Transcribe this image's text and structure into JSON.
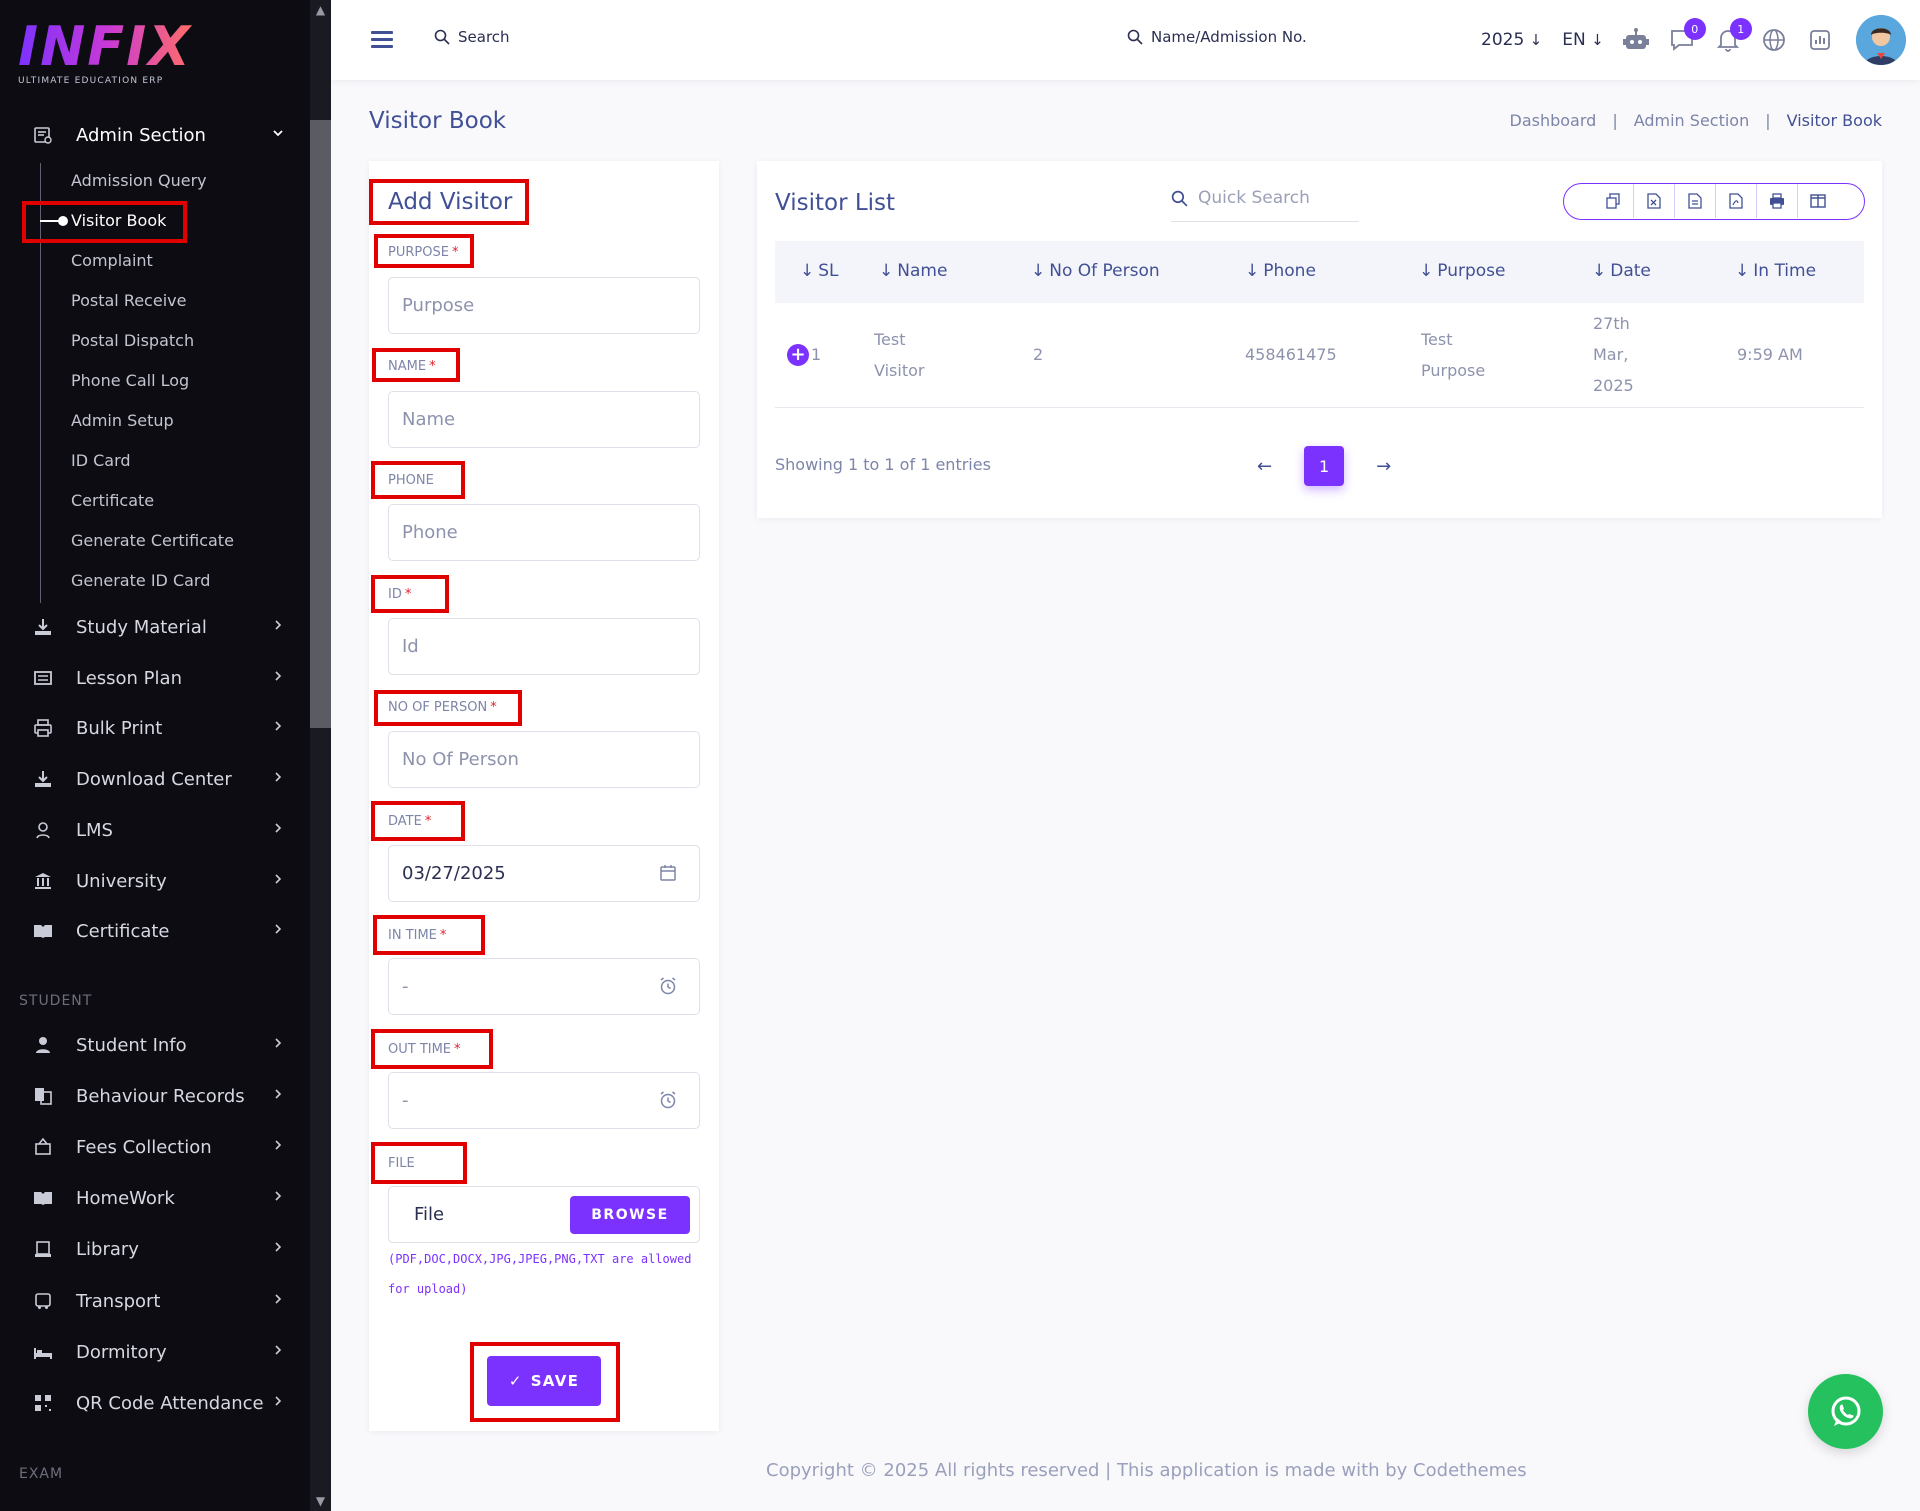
{
  "brand": {
    "logo": "INFIX",
    "tagline": "ULTIMATE EDUCATION ERP"
  },
  "sidebar": {
    "admin_section": "Admin Section",
    "submenu": [
      "Admission Query",
      "Visitor Book",
      "Complaint",
      "Postal Receive",
      "Postal Dispatch",
      "Phone Call Log",
      "Admin Setup",
      "ID Card",
      "Certificate",
      "Generate Certificate",
      "Generate ID Card"
    ],
    "main_items": [
      "Study Material",
      "Lesson Plan",
      "Bulk Print",
      "Download Center",
      "LMS",
      "University",
      "Certificate"
    ],
    "student_title": "STUDENT",
    "student_items": [
      "Student Info",
      "Behaviour Records",
      "Fees Collection",
      "HomeWork",
      "Library",
      "Transport",
      "Dormitory",
      "QR Code Attendance"
    ],
    "exam_title": "EXAM"
  },
  "header": {
    "search_label": "Search",
    "student_search_label": "Name/Admission No.",
    "year": "2025",
    "lang": "EN",
    "chat_badge": "0",
    "notif_badge": "1"
  },
  "page": {
    "title": "Visitor Book",
    "breadcrumb": [
      "Dashboard",
      "Admin Section",
      "Visitor Book"
    ]
  },
  "form": {
    "title": "Add Visitor",
    "purpose_label": "PURPOSE",
    "purpose_placeholder": "Purpose",
    "name_label": "NAME",
    "name_placeholder": "Name",
    "phone_label": "PHONE",
    "phone_placeholder": "Phone",
    "id_label": "ID",
    "id_placeholder": "Id",
    "persons_label": "NO OF PERSON",
    "persons_placeholder": "No Of Person",
    "date_label": "DATE",
    "date_value": "03/27/2025",
    "in_time_label": "IN TIME",
    "in_time_value": "-",
    "out_time_label": "OUT TIME",
    "out_time_value": "-",
    "file_label": "FILE",
    "file_placeholder": "File",
    "browse_label": "BROWSE",
    "file_note": "(PDF,DOC,DOCX,JPG,JPEG,PNG,TXT are allowed for upload)",
    "required_mark": "*",
    "save_label": "SAVE"
  },
  "list": {
    "title": "Visitor List",
    "quick_search_placeholder": "Quick Search",
    "columns": [
      "SL",
      "Name",
      "No Of Person",
      "Phone",
      "Purpose",
      "Date",
      "In Time"
    ],
    "rows": [
      {
        "sl": "1",
        "name": "Test Visitor",
        "persons": "2",
        "phone": "458461475",
        "purpose": "Test Purpose",
        "date": "27th Mar, 2025",
        "in_time": "9:59 AM"
      }
    ],
    "showing": "Showing 1 to 1 of 1 entries",
    "page": "1"
  },
  "footer": {
    "text": "Copyright © 2025 All rights reserved | This application is made with by Codethemes"
  },
  "colors": {
    "accent": "#7c32ff",
    "highlight": "#e10000",
    "sidebar_bg": "#0c0c12",
    "whatsapp": "#25c15f"
  }
}
